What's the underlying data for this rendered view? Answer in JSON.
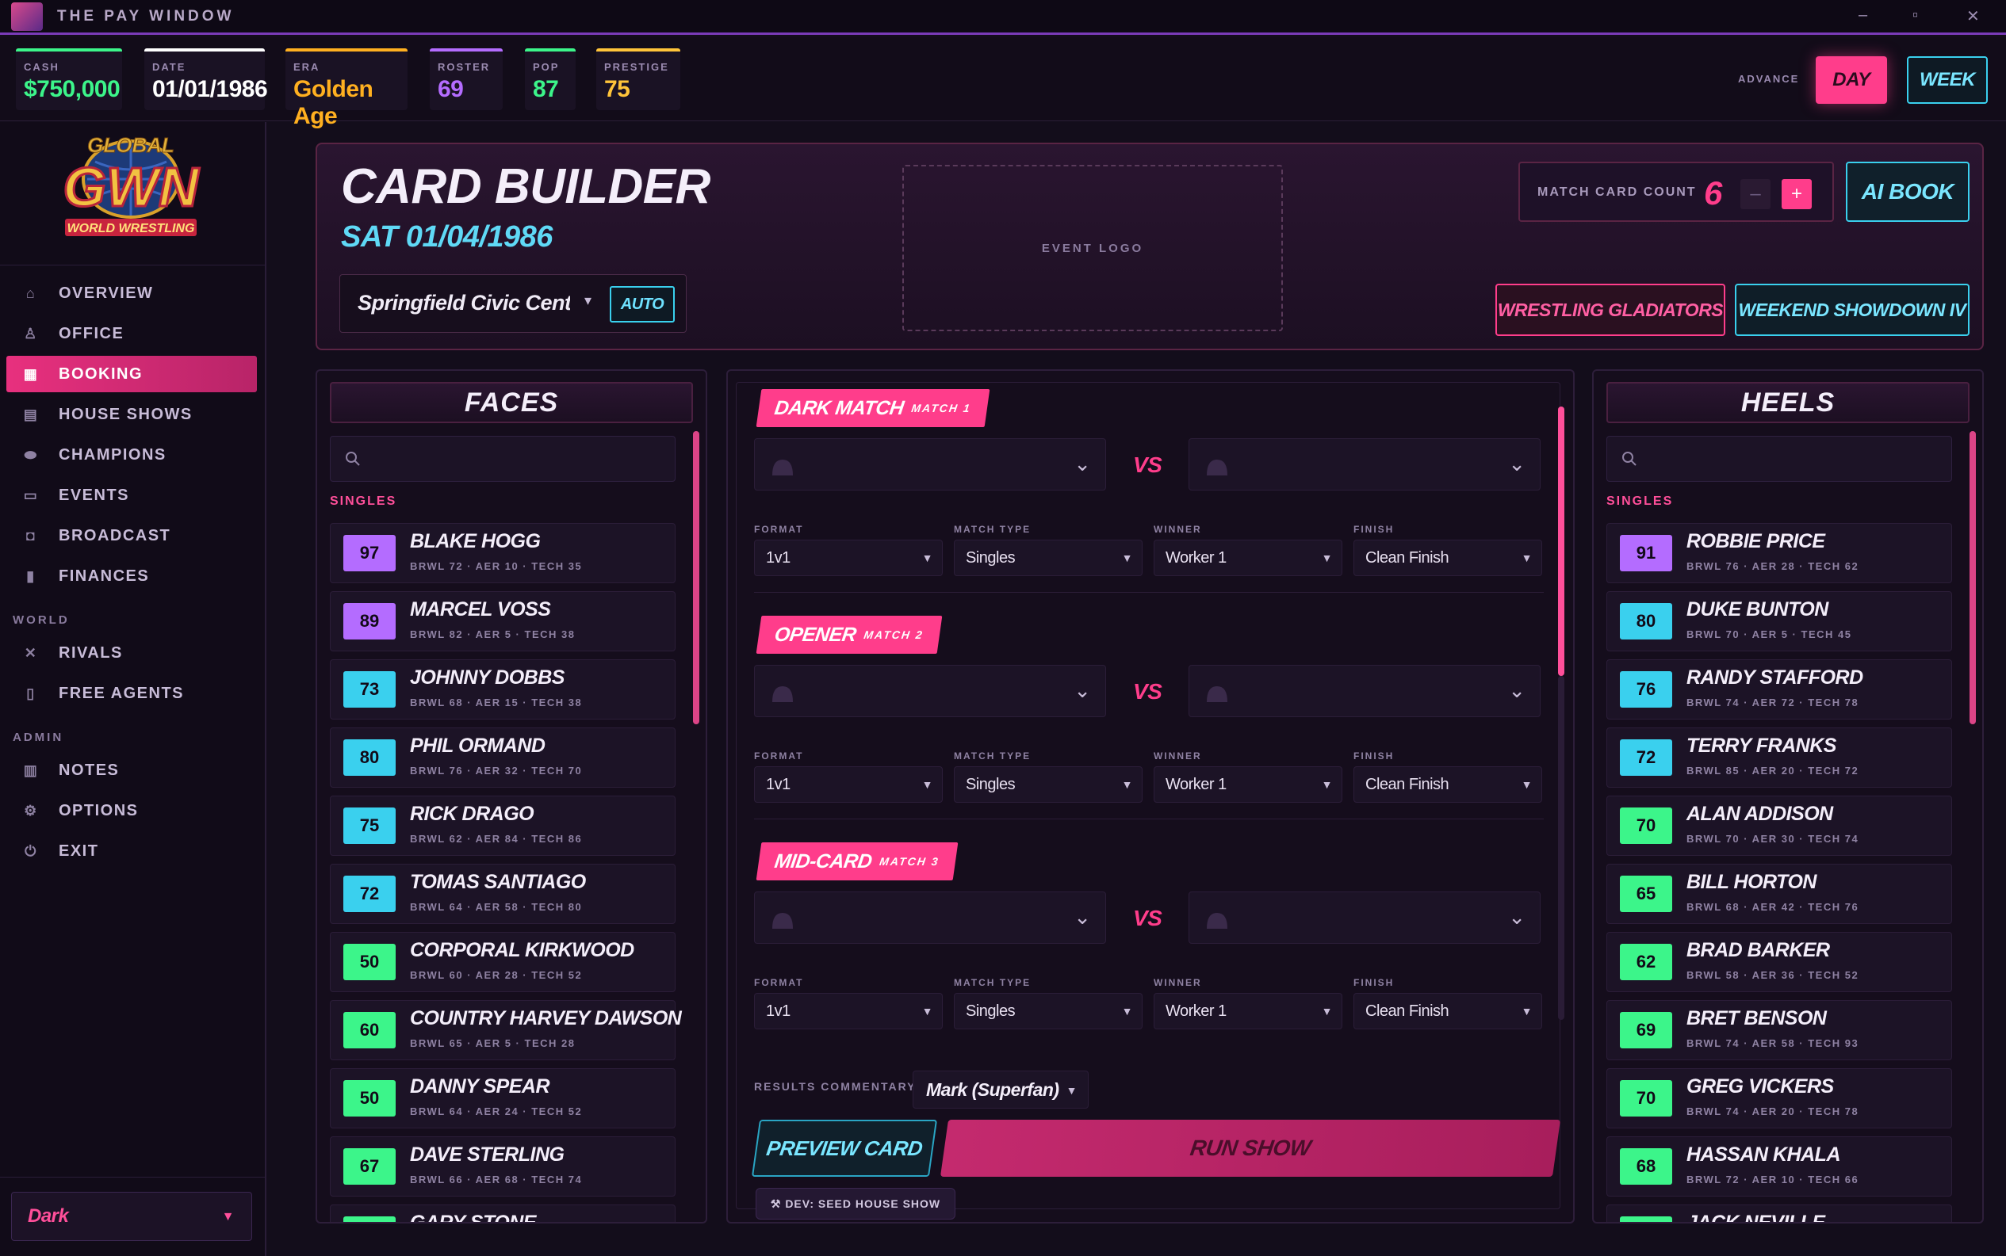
{
  "window": {
    "title": "THE PAY WINDOW",
    "min": "–",
    "max": "▫",
    "close": "✕"
  },
  "stats": [
    {
      "label": "CASH",
      "value": "$750,000",
      "color": "#3cf58a"
    },
    {
      "label": "DATE",
      "value": "01/01/1986",
      "color": "#ffffff"
    },
    {
      "label": "ERA",
      "value": "Golden Age",
      "color": "#ffb020"
    },
    {
      "label": "ROSTER",
      "value": "69",
      "color": "#b46cff"
    },
    {
      "label": "POP",
      "value": "87",
      "color": "#3cf58a"
    },
    {
      "label": "PRESTIGE",
      "value": "75",
      "color": "#ffc43a"
    }
  ],
  "advance": {
    "label": "ADVANCE",
    "day": "DAY",
    "week": "WEEK"
  },
  "sidebar": {
    "logo": {
      "top": "GLOBAL",
      "main": "GWN",
      "bottom": "WORLD WRESTLING"
    },
    "items": [
      {
        "label": "OVERVIEW",
        "icon": "home-icon"
      },
      {
        "label": "OFFICE",
        "icon": "user-icon"
      },
      {
        "label": "BOOKING",
        "icon": "calendar-icon"
      },
      {
        "label": "HOUSE SHOWS",
        "icon": "building-icon"
      },
      {
        "label": "CHAMPIONS",
        "icon": "belt-icon"
      },
      {
        "label": "EVENTS",
        "icon": "monitor-icon"
      },
      {
        "label": "BROADCAST",
        "icon": "camera-icon"
      },
      {
        "label": "FINANCES",
        "icon": "chart-icon"
      }
    ],
    "world_label": "WORLD",
    "world_items": [
      {
        "label": "RIVALS",
        "icon": "versus-icon"
      },
      {
        "label": "FREE AGENTS",
        "icon": "document-icon"
      }
    ],
    "admin_label": "ADMIN",
    "admin_items": [
      {
        "label": "NOTES",
        "icon": "clipboard-icon"
      },
      {
        "label": "OPTIONS",
        "icon": "gear-icon"
      },
      {
        "label": "EXIT",
        "icon": "power-icon"
      }
    ],
    "theme": "Dark"
  },
  "header": {
    "title": "CARD BUILDER",
    "date": "SAT 01/04/1986",
    "venue": "Springfield Civic Center",
    "auto": "AUTO",
    "event_logo": "EVENT LOGO",
    "match_card_count_label": "MATCH CARD COUNT",
    "match_card_count": "6",
    "minus": "–",
    "plus": "+",
    "ai_book": "AI BOOK",
    "shows": [
      "WRESTLING GLADIATORS",
      "WEEKEND SHOWDOWN IV"
    ]
  },
  "faces": {
    "title": "FACES",
    "section": "SINGLES",
    "workers": [
      {
        "ovr": "97",
        "name": "BLAKE HOGG",
        "stats": "BRWL 72 · AER 10 · TECH 35",
        "color": "#b46cff"
      },
      {
        "ovr": "89",
        "name": "MARCEL VOSS",
        "stats": "BRWL 82 · AER 5 · TECH 38",
        "color": "#b46cff"
      },
      {
        "ovr": "73",
        "name": "JOHNNY DOBBS",
        "stats": "BRWL 68 · AER 15 · TECH 38",
        "color": "#3ad0ee"
      },
      {
        "ovr": "80",
        "name": "PHIL ORMAND",
        "stats": "BRWL 76 · AER 32 · TECH 70",
        "color": "#3ad0ee"
      },
      {
        "ovr": "75",
        "name": "RICK DRAGO",
        "stats": "BRWL 62 · AER 84 · TECH 86",
        "color": "#3ad0ee"
      },
      {
        "ovr": "72",
        "name": "TOMAS SANTIAGO",
        "stats": "BRWL 64 · AER 58 · TECH 80",
        "color": "#3ad0ee"
      },
      {
        "ovr": "50",
        "name": "CORPORAL KIRKWOOD",
        "stats": "BRWL 60 · AER 28 · TECH 52",
        "color": "#3cf58a"
      },
      {
        "ovr": "60",
        "name": "COUNTRY HARVEY DAWSON",
        "stats": "BRWL 65 · AER 5 · TECH 28",
        "color": "#3cf58a"
      },
      {
        "ovr": "50",
        "name": "DANNY SPEAR",
        "stats": "BRWL 64 · AER 24 · TECH 52",
        "color": "#3cf58a"
      },
      {
        "ovr": "67",
        "name": "DAVE STERLING",
        "stats": "BRWL 66 · AER 68 · TECH 74",
        "color": "#3cf58a"
      },
      {
        "ovr": "",
        "name": "GARY STONE",
        "stats": "",
        "color": "#3cf58a"
      }
    ]
  },
  "heels": {
    "title": "HEELS",
    "section": "SINGLES",
    "workers": [
      {
        "ovr": "91",
        "name": "ROBBIE PRICE",
        "stats": "BRWL 76 · AER 28 · TECH 62",
        "color": "#b46cff"
      },
      {
        "ovr": "80",
        "name": "DUKE BUNTON",
        "stats": "BRWL 70 · AER 5 · TECH 45",
        "color": "#3ad0ee"
      },
      {
        "ovr": "76",
        "name": "RANDY STAFFORD",
        "stats": "BRWL 74 · AER 72 · TECH 78",
        "color": "#3ad0ee"
      },
      {
        "ovr": "72",
        "name": "TERRY FRANKS",
        "stats": "BRWL 85 · AER 20 · TECH 72",
        "color": "#3ad0ee"
      },
      {
        "ovr": "70",
        "name": "ALAN ADDISON",
        "stats": "BRWL 70 · AER 30 · TECH 74",
        "color": "#3cf58a"
      },
      {
        "ovr": "65",
        "name": "BILL HORTON",
        "stats": "BRWL 68 · AER 42 · TECH 76",
        "color": "#3cf58a"
      },
      {
        "ovr": "62",
        "name": "BRAD BARKER",
        "stats": "BRWL 58 · AER 36 · TECH 52",
        "color": "#3cf58a"
      },
      {
        "ovr": "69",
        "name": "BRET BENSON",
        "stats": "BRWL 74 · AER 58 · TECH 93",
        "color": "#3cf58a"
      },
      {
        "ovr": "70",
        "name": "GREG VICKERS",
        "stats": "BRWL 74 · AER 20 · TECH 78",
        "color": "#3cf58a"
      },
      {
        "ovr": "68",
        "name": "HASSAN KHALA",
        "stats": "BRWL 72 · AER 10 · TECH 66",
        "color": "#3cf58a"
      },
      {
        "ovr": "",
        "name": "JACK NEVILLE",
        "stats": "",
        "color": "#3cf58a"
      }
    ]
  },
  "matches": [
    {
      "tag": "DARK MATCH",
      "num": "MATCH 1",
      "vs": "VS",
      "fields": [
        {
          "label": "FORMAT",
          "value": "1v1"
        },
        {
          "label": "MATCH TYPE",
          "value": "Singles"
        },
        {
          "label": "WINNER",
          "value": "Worker 1"
        },
        {
          "label": "FINISH",
          "value": "Clean Finish"
        }
      ]
    },
    {
      "tag": "OPENER",
      "num": "MATCH 2",
      "vs": "VS",
      "fields": [
        {
          "label": "FORMAT",
          "value": "1v1"
        },
        {
          "label": "MATCH TYPE",
          "value": "Singles"
        },
        {
          "label": "WINNER",
          "value": "Worker 1"
        },
        {
          "label": "FINISH",
          "value": "Clean Finish"
        }
      ]
    },
    {
      "tag": "MID-CARD",
      "num": "MATCH 3",
      "vs": "VS",
      "fields": [
        {
          "label": "FORMAT",
          "value": "1v1"
        },
        {
          "label": "MATCH TYPE",
          "value": "Singles"
        },
        {
          "label": "WINNER",
          "value": "Worker 1"
        },
        {
          "label": "FINISH",
          "value": "Clean Finish"
        }
      ]
    }
  ],
  "footer": {
    "results_label": "RESULTS COMMENTARY",
    "results_value": "Mark (Superfan)",
    "preview": "PREVIEW CARD",
    "run": "RUN SHOW",
    "dev": "⚒ DEV: SEED HOUSE SHOW"
  }
}
